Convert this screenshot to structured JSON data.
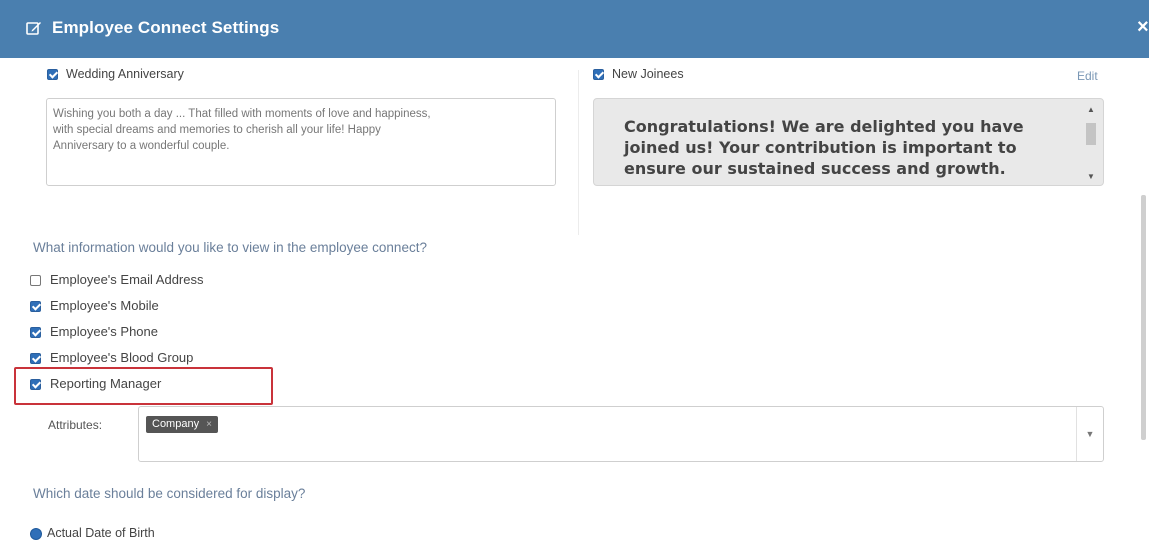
{
  "header": {
    "title": "Employee Connect Settings",
    "edit_icon": "edit-square-icon",
    "close": "×"
  },
  "wedding": {
    "label": "Wedding Anniversary",
    "checked": true,
    "message_lines": [
      "Wishing you both a day ... That filled with moments of love and happiness,",
      "with special dreams and memories to cherish all your life! Happy",
      "Anniversary to a wonderful couple."
    ]
  },
  "new_joinees": {
    "label": "New Joinees",
    "checked": true,
    "edit_link": "Edit",
    "message_lines": [
      "Congratulations! We are delighted you have",
      "joined us! Your contribution is important to",
      "ensure our sustained success and growth."
    ]
  },
  "info_question": "What information would you like to view in the employee connect?",
  "info_options": [
    {
      "label": "Employee's Email Address",
      "checked": false
    },
    {
      "label": "Employee's Mobile",
      "checked": true
    },
    {
      "label": "Employee's Phone",
      "checked": true
    },
    {
      "label": "Employee's Blood Group",
      "checked": true
    },
    {
      "label": "Reporting Manager",
      "checked": true
    }
  ],
  "attributes": {
    "label": "Attributes:",
    "tag": "Company",
    "tag_remove": "×"
  },
  "date_question": "Which date should be considered for display?",
  "date_option": {
    "label": "Actual Date of Birth",
    "selected": true
  },
  "colors": {
    "header": "#4a7faf",
    "checkbox": "#2f6fb8",
    "highlight": "#c9333a"
  }
}
